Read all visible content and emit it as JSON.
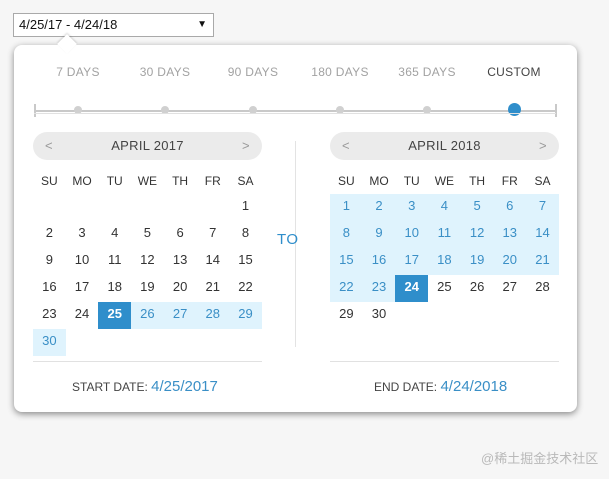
{
  "range_select": {
    "value": "4/25/17 - 4/24/18",
    "arrow": "▼"
  },
  "presets": [
    {
      "label": "7 DAYS",
      "active": false
    },
    {
      "label": "30 DAYS",
      "active": false
    },
    {
      "label": "90 DAYS",
      "active": false
    },
    {
      "label": "180 DAYS",
      "active": false
    },
    {
      "label": "365 DAYS",
      "active": false
    },
    {
      "label": "CUSTOM",
      "active": true
    }
  ],
  "weekdays": [
    "SU",
    "MO",
    "TU",
    "WE",
    "TH",
    "FR",
    "SA"
  ],
  "nav_prev": "<",
  "nav_next": ">",
  "to_label": "TO",
  "start_calendar": {
    "title": "APRIL 2017",
    "days": [
      "",
      "",
      "",
      "",
      "",
      "",
      "1",
      "2",
      "3",
      "4",
      "5",
      "6",
      "7",
      "8",
      "9",
      "10",
      "11",
      "12",
      "13",
      "14",
      "15",
      "16",
      "17",
      "18",
      "19",
      "20",
      "21",
      "22",
      "23",
      "24",
      "25",
      "26",
      "27",
      "28",
      "29",
      "30"
    ],
    "selected": "25",
    "range_days": [
      "26",
      "27",
      "28",
      "29",
      "30"
    ]
  },
  "end_calendar": {
    "title": "APRIL 2018",
    "days": [
      "1",
      "2",
      "3",
      "4",
      "5",
      "6",
      "7",
      "8",
      "9",
      "10",
      "11",
      "12",
      "13",
      "14",
      "15",
      "16",
      "17",
      "18",
      "19",
      "20",
      "21",
      "22",
      "23",
      "24",
      "25",
      "26",
      "27",
      "28",
      "29",
      "30"
    ],
    "selected": "24",
    "range_days": [
      "1",
      "2",
      "3",
      "4",
      "5",
      "6",
      "7",
      "8",
      "9",
      "10",
      "11",
      "12",
      "13",
      "14",
      "15",
      "16",
      "17",
      "18",
      "19",
      "20",
      "21",
      "22",
      "23"
    ]
  },
  "start_date": {
    "label": "START DATE:",
    "value": "4/25/2017"
  },
  "end_date": {
    "label": "END DATE:",
    "value": "4/24/2018"
  },
  "watermark": "@稀土掘金技术社区",
  "colors": {
    "accent": "#2f8ecb",
    "range_bg": "#dff3fd",
    "range_text": "#3a8fc6"
  }
}
